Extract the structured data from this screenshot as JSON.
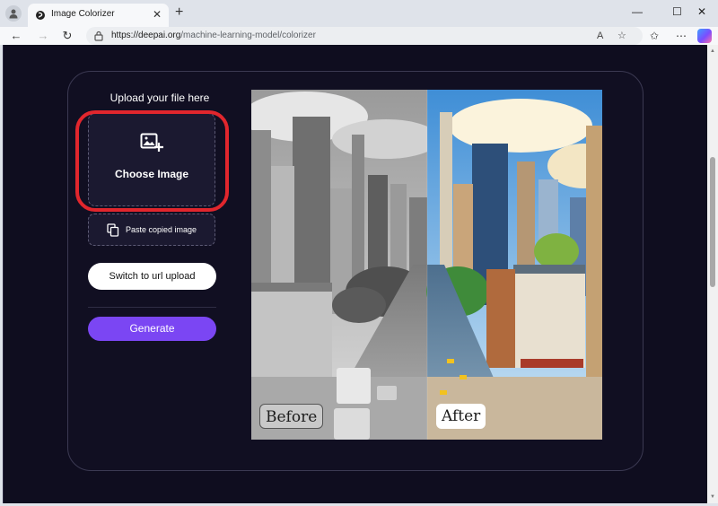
{
  "browser": {
    "tab_title": "Image Colorizer",
    "tab_close": "✕",
    "new_tab": "+",
    "url_scheme_host": "https://deepai.org",
    "url_path": "/machine-learning-model/colorizer",
    "nav": {
      "back": "←",
      "forward": "→",
      "reload": "↻"
    },
    "read_aloud": "A",
    "favorite": "☆",
    "favorites_bar": "✩",
    "more": "⋯",
    "window": {
      "minimize": "—",
      "maximize": "☐",
      "close": "✕"
    },
    "scroll_up": "▲",
    "scroll_down": "▼"
  },
  "upload": {
    "title": "Upload your file here",
    "choose_image": "Choose Image",
    "paste": "Paste copied image",
    "switch_url": "Switch to url upload",
    "generate": "Generate"
  },
  "preview": {
    "before_label": "Before",
    "after_label": "After"
  },
  "colors": {
    "page_bg": "#0f0d1f",
    "panel_border": "#3b3952",
    "generate_btn": "#7b46f3",
    "highlight": "#e1262d"
  }
}
